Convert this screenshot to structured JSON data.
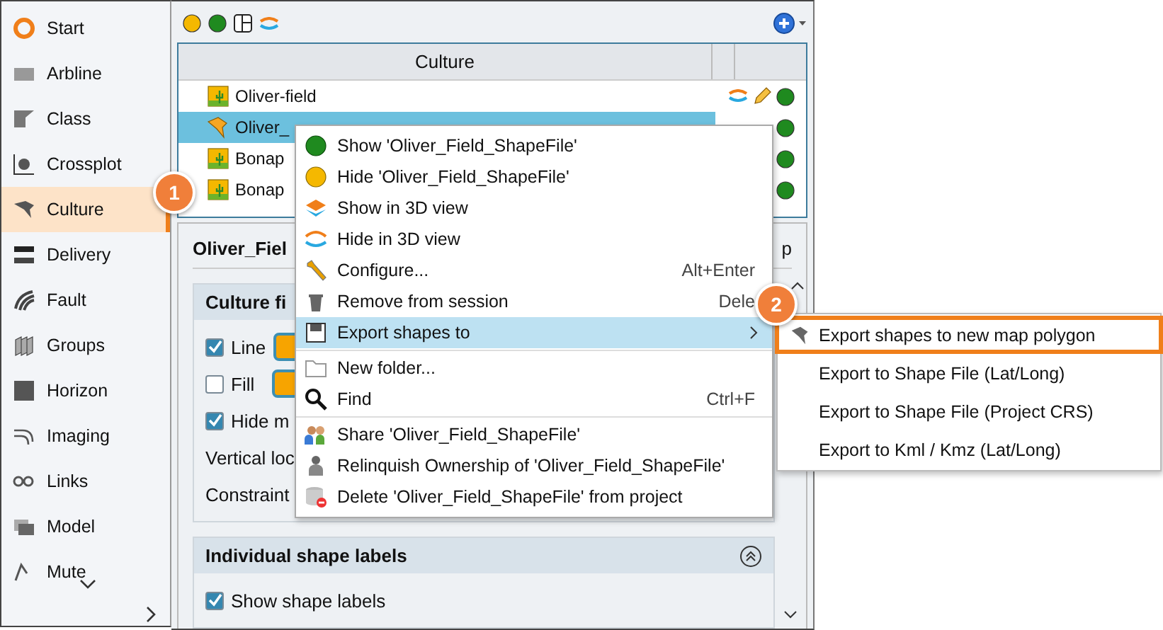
{
  "sidebar": {
    "items": [
      {
        "label": "Start",
        "selected": false
      },
      {
        "label": "Arbline",
        "selected": false
      },
      {
        "label": "Class",
        "selected": false
      },
      {
        "label": "Crossplot",
        "selected": false
      },
      {
        "label": "Culture",
        "selected": true
      },
      {
        "label": "Delivery",
        "selected": false
      },
      {
        "label": "Fault",
        "selected": false
      },
      {
        "label": "Groups",
        "selected": false
      },
      {
        "label": "Horizon",
        "selected": false
      },
      {
        "label": "Imaging",
        "selected": false
      },
      {
        "label": "Links",
        "selected": false
      },
      {
        "label": "Model",
        "selected": false
      },
      {
        "label": "Mute",
        "selected": false
      }
    ]
  },
  "table": {
    "columns": [
      "Culture"
    ],
    "rows": [
      {
        "name": "Oliver-field",
        "kind": "field",
        "selected": false
      },
      {
        "name": "Oliver_",
        "kind": "shape",
        "selected": true
      },
      {
        "name": "Bonap",
        "kind": "field",
        "selected": false
      },
      {
        "name": "Bonap",
        "kind": "field",
        "selected": false
      }
    ]
  },
  "panel": {
    "title": "Oliver_Fiel",
    "title_end": "p",
    "groups": [
      {
        "title": "Culture fi",
        "rows": [
          {
            "kind": "color_checkbox",
            "label": "Line",
            "checked": true
          },
          {
            "kind": "color_checkbox",
            "label": "Fill",
            "checked": false
          },
          {
            "kind": "checkbox",
            "label": "Hide m",
            "checked": true
          },
          {
            "kind": "text",
            "label": "Vertical loc"
          },
          {
            "kind": "text",
            "label": "Constraint"
          }
        ]
      },
      {
        "title": "Individual shape labels",
        "expanded": true,
        "rows": [
          {
            "kind": "checkbox",
            "label": "Show shape labels",
            "checked": true
          }
        ]
      }
    ]
  },
  "context_menu": {
    "items": [
      {
        "label": "Show 'Oliver_Field_ShapeFile'",
        "selected": false
      },
      {
        "label": "Hide 'Oliver_Field_ShapeFile'",
        "selected": false
      },
      {
        "label": "Show in 3D view",
        "selected": false
      },
      {
        "label": "Hide in 3D view",
        "selected": false
      },
      {
        "label": "Configure...",
        "shortcut": "Alt+Enter",
        "selected": false
      },
      {
        "label": "Remove from session",
        "shortcut": "Dele",
        "selected": false
      },
      {
        "label": "Export shapes to",
        "submenu": true,
        "selected": true
      },
      {
        "label": "New folder...",
        "separator_before": true,
        "selected": false
      },
      {
        "label": "Find",
        "shortcut": "Ctrl+F",
        "selected": false
      },
      {
        "label": "Share 'Oliver_Field_ShapeFile'",
        "separator_before": true,
        "selected": false
      },
      {
        "label": "Relinquish Ownership of 'Oliver_Field_ShapeFile'",
        "selected": false
      },
      {
        "label": "Delete 'Oliver_Field_ShapeFile' from project",
        "selected": false
      }
    ]
  },
  "submenu": {
    "items": [
      {
        "label": "Export shapes to new map polygon",
        "selected": true
      },
      {
        "label": "Export to Shape File (Lat/Long)",
        "selected": false
      },
      {
        "label": "Export to Shape File (Project CRS)",
        "selected": false
      },
      {
        "label": "Export to Kml / Kmz (Lat/Long)",
        "selected": false
      }
    ]
  },
  "callouts": [
    "1",
    "2"
  ]
}
